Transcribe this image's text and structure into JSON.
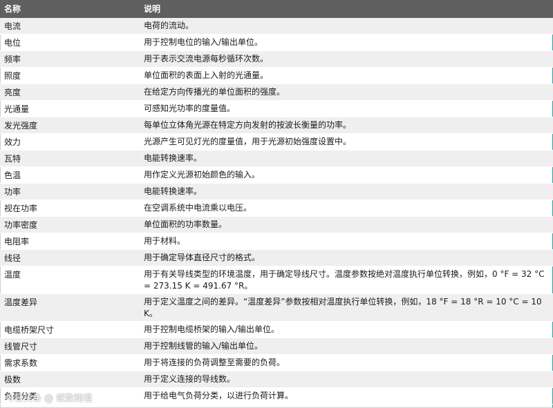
{
  "header": {
    "name": "名称",
    "description": "说明"
  },
  "rows": [
    {
      "name": "电流",
      "description": "电荷的流动。"
    },
    {
      "name": "电位",
      "description": "用于控制电位的输入/输出单位。"
    },
    {
      "name": "频率",
      "description": "用于表示交流电源每秒循环次数。"
    },
    {
      "name": "照度",
      "description": "单位面积的表面上入射的光通量。"
    },
    {
      "name": "亮度",
      "description": "在给定方向传播光的单位面积的强度。"
    },
    {
      "name": "光通量",
      "description": "可感知光功率的度量值。"
    },
    {
      "name": "发光强度",
      "description": "每单位立体角光源在特定方向发射的按波长衡量的功率。"
    },
    {
      "name": "效力",
      "description": "光源产生可见灯光的度量值，用于光源初始强度设置中。"
    },
    {
      "name": "瓦特",
      "description": "电能转换速率。"
    },
    {
      "name": "色温",
      "description": "用作定义光源初始颜色的输入。"
    },
    {
      "name": "功率",
      "description": "电能转换速率。"
    },
    {
      "name": "视在功率",
      "description": "在空调系统中电流乘以电压。"
    },
    {
      "name": "功率密度",
      "description": "单位面积的功率数量。"
    },
    {
      "name": "电阻率",
      "description": "用于材料。"
    },
    {
      "name": "线径",
      "description": "用于确定导体直径尺寸的格式。"
    },
    {
      "name": "温度",
      "description": "用于有关导线类型的环境温度，用于确定导线尺寸。温度参数按绝对温度执行单位转换，例如，0 °F = 32 °C = 273.15 K = 491.67 °R。"
    },
    {
      "name": "温度差异",
      "description": "用于定义温度之间的差异。“温度差异”参数按相对温度执行单位转换，例如，18 °F = 18 °R = 10 °C = 10 K。"
    },
    {
      "name": "电缆桥架尺寸",
      "description": "用于控制电缆桥架的输入/输出单位。"
    },
    {
      "name": "线管尺寸",
      "description": "用于控制线管的输入/输出单位。"
    },
    {
      "name": "需求系数",
      "description": "用于将连接的负荷调整至需要的负荷。"
    },
    {
      "name": "极数",
      "description": "用于定义连接的导线数。"
    },
    {
      "name": "负荷分类",
      "description": "用于给电气负荷分类，以进行负荷计算。"
    }
  ],
  "watermark": "今日头条 @ 蚁数跨境"
}
